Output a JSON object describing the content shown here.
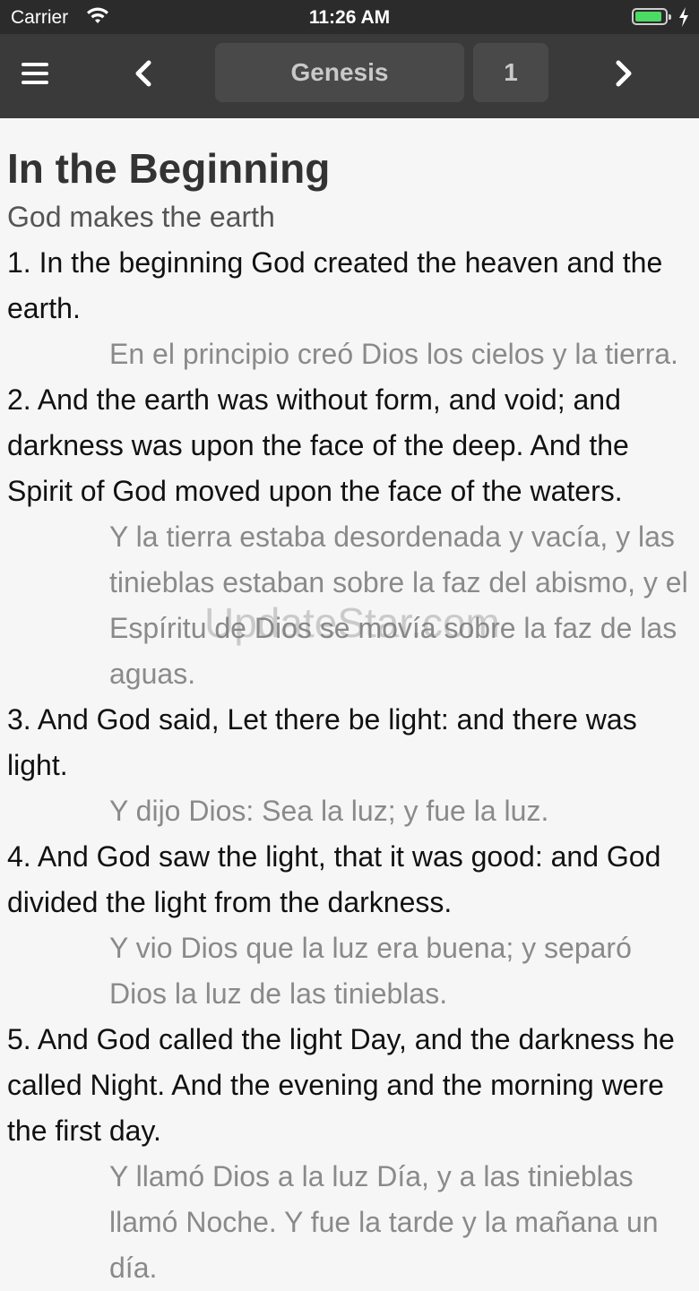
{
  "status": {
    "carrier": "Carrier",
    "time": "11:26 AM"
  },
  "nav": {
    "book": "Genesis",
    "chapter": "1"
  },
  "chapter": {
    "title": "In the Beginning",
    "subtitle": "God makes the earth",
    "verses": [
      {
        "text": "1. In the beginning God created the heaven and the earth.",
        "translation": "En el principio creó Dios los cielos y la tierra."
      },
      {
        "text": "2. And the earth was without form, and void; and darkness was upon the face of the deep. And the Spirit of God moved upon the face of the waters.",
        "translation": "Y la tierra estaba desordenada y vacía, y las tinieblas estaban sobre la faz del abismo, y el Espíritu de Dios se movía sobre la faz de las aguas."
      },
      {
        "text": "3. And God said, Let there be light: and there was light.",
        "translation": "Y dijo Dios: Sea la luz; y fue la luz."
      },
      {
        "text": "4. And God saw the light, that it was good: and God divided the light from the darkness.",
        "translation": "Y vio Dios que la luz era buena; y separó Dios la luz de las tinieblas."
      },
      {
        "text": "5. And God called the light Day, and the darkness he called Night. And the evening and the morning were the first day.",
        "translation": "Y llamó Dios a la luz Día, y a las tinieblas llamó Noche. Y fue la tarde y la mañana un día."
      }
    ]
  },
  "watermark": "UpdateStar.com",
  "icons": {
    "wifi": "wifi-icon",
    "battery": "battery-icon",
    "charging": "charging-icon",
    "menu": "menu-icon",
    "back": "chevron-left-icon",
    "forward": "chevron-right-icon"
  },
  "colors": {
    "navbar": "#3a3a3a",
    "statusbar": "#2b2b2b",
    "battery": "#4cd964",
    "translation": "#8a8a8a"
  }
}
